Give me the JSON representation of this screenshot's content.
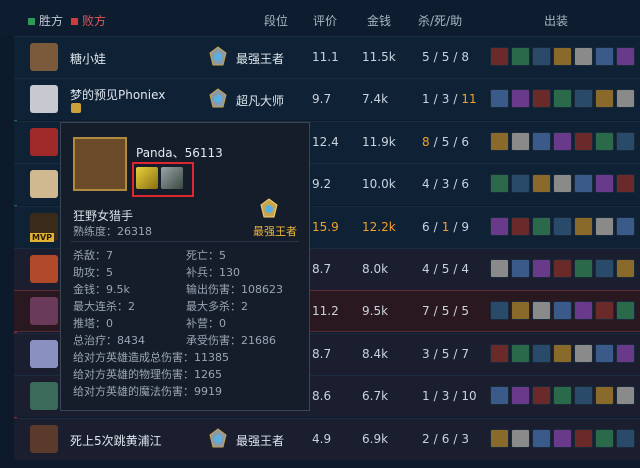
{
  "legend": {
    "win": "胜方",
    "lose": "败方"
  },
  "columns": {
    "rank": "段位",
    "rating": "评价",
    "gold": "金钱",
    "kda": "杀/死/助",
    "items": "出装"
  },
  "players": [
    {
      "name": "糖小娃",
      "rank": "最强王者",
      "rating": "11.1",
      "gold": "11.5k",
      "k": "5",
      "d": "5",
      "a": "8"
    },
    {
      "name": "梦的预见Phoniex",
      "rank": "超凡大师",
      "rating": "9.7",
      "gold": "7.4k",
      "k": "1",
      "d": "3",
      "a": "11"
    },
    {
      "name": "",
      "rank": "",
      "rating": "12.4",
      "gold": "11.9k",
      "k": "8",
      "d": "5",
      "a": "6"
    },
    {
      "name": "",
      "rank": "",
      "rating": "9.2",
      "gold": "10.0k",
      "k": "4",
      "d": "3",
      "a": "6"
    },
    {
      "name": "",
      "rank": "",
      "rating": "15.9",
      "gold": "12.2k",
      "k": "6",
      "d": "1",
      "a": "9",
      "badge": "MVP"
    },
    {
      "name": "",
      "rank": "",
      "rating": "8.7",
      "gold": "8.0k",
      "k": "4",
      "d": "5",
      "a": "4"
    },
    {
      "name": "",
      "rank": "",
      "rating": "11.2",
      "gold": "9.5k",
      "k": "7",
      "d": "5",
      "a": "5"
    },
    {
      "name": "",
      "rank": "",
      "rating": "8.7",
      "gold": "8.4k",
      "k": "3",
      "d": "5",
      "a": "7"
    },
    {
      "name": "",
      "rank": "",
      "rating": "8.6",
      "gold": "6.7k",
      "k": "1",
      "d": "3",
      "a": "10"
    },
    {
      "name": "死上5次跳黄浦江",
      "rank": "最强王者",
      "rating": "4.9",
      "gold": "6.9k",
      "k": "2",
      "d": "6",
      "a": "3"
    }
  ],
  "popup": {
    "name": "Panda、56113",
    "champion": "狂野女猎手",
    "mastery": "熟练度：26318",
    "rank": "最强王者",
    "stats": [
      [
        "杀敌：7",
        "死亡：5"
      ],
      [
        "助攻：5",
        "补兵：130"
      ],
      [
        "金钱：9.5k",
        "输出伤害：108623"
      ],
      [
        "最大连杀：2",
        "最大多杀：2"
      ],
      [
        "推塔：0",
        "补营：0"
      ],
      [
        "总治疗：8434",
        "承受伤害：21686"
      ]
    ],
    "extra": [
      "给对方英雄造成总伤害：11385",
      "给对方英雄的物理伤害：1265",
      "给对方英雄的魔法伤害：9919"
    ]
  },
  "colors": {
    "win": "#2e9a5a",
    "lose": "#d03b3b",
    "accent": "#f2a02c"
  }
}
